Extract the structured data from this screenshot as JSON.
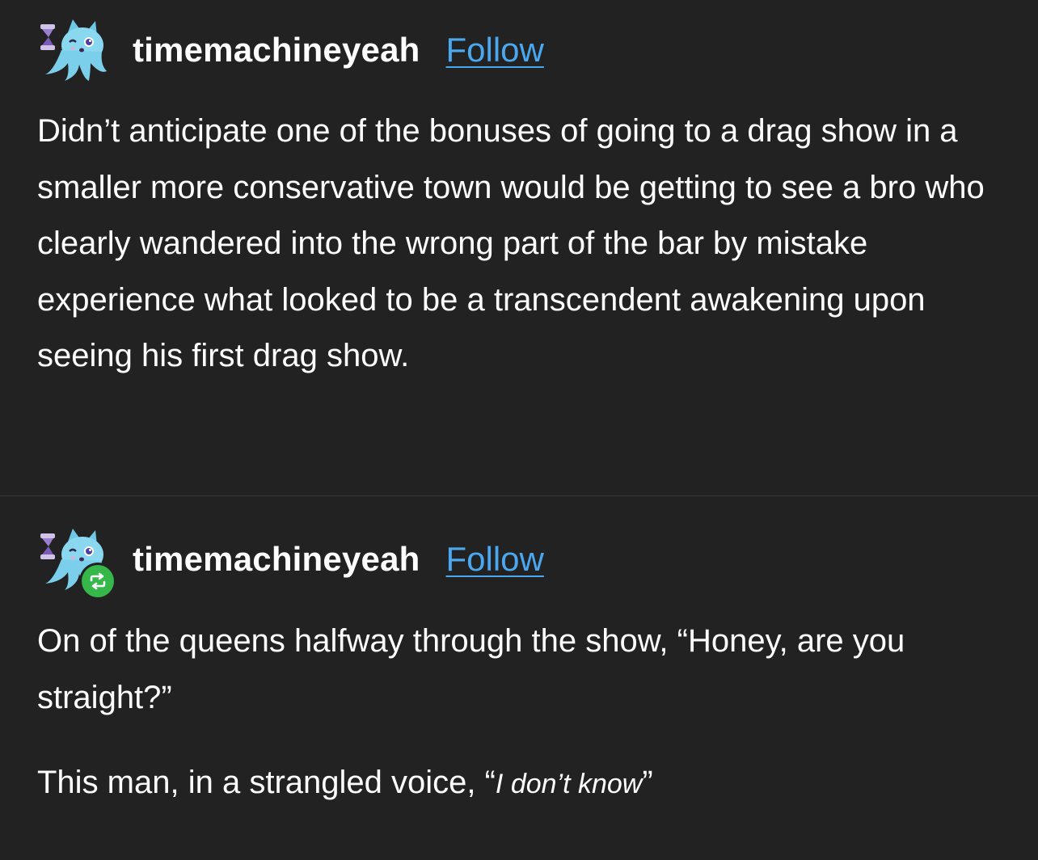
{
  "posts": [
    {
      "username": "timemachineyeah",
      "follow_label": "Follow",
      "paragraphs": [
        "Didn’t anticipate one of the bonuses of going to a drag show in a smaller more conservative town would be getting to see a bro who clearly wandered into the wrong part of the bar by mistake experience what looked to be a transcendent awakening upon seeing his first drag show."
      ]
    },
    {
      "username": "timemachineyeah",
      "follow_label": "Follow",
      "reblogged": true,
      "paragraphs": [
        "On of the queens halfway through the show, “Honey, are you straight?”"
      ],
      "last_paragraph": {
        "lead": "This man, in a strangled voice, “",
        "italic": "I don’t know",
        "trail": "”"
      }
    }
  ],
  "colors": {
    "background": "#222222",
    "text": "#ffffff",
    "link": "#4aa8f0",
    "reblog_badge": "#36b74a"
  },
  "icons": {
    "avatar": "ghost-cat-avatar-icon",
    "reblog": "reblog-icon"
  }
}
